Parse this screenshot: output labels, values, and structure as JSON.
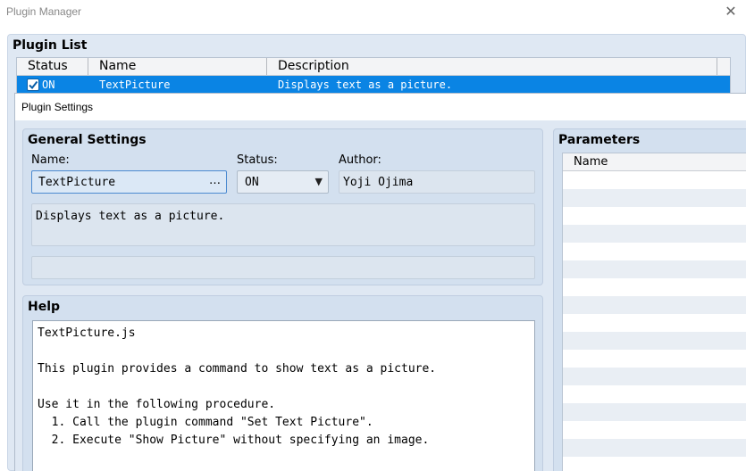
{
  "manager": {
    "title": "Plugin Manager",
    "close_icon": "close-icon",
    "list_title": "Plugin List",
    "columns": [
      "Status",
      "Name",
      "Description"
    ],
    "selected_row": {
      "status": "ON",
      "checked": true,
      "name": "TextPicture",
      "description": "Displays text as a picture."
    }
  },
  "settings": {
    "title": "Plugin Settings",
    "general": {
      "title": "General Settings",
      "name_label": "Name:",
      "name_value": "TextPicture",
      "name_browse": "…",
      "status_label": "Status:",
      "status_value": "ON",
      "author_label": "Author:",
      "author_value": "Yoji Ojima",
      "description_value": "Displays text as a picture.",
      "extra_value": ""
    },
    "help": {
      "title": "Help",
      "lines": [
        "TextPicture.js",
        "",
        "This plugin provides a command to show text as a picture.",
        "",
        "Use it in the following procedure.",
        "  1. Call the plugin command \"Set Text Picture\".",
        "  2. Execute \"Show Picture\" without specifying an image."
      ]
    },
    "parameters": {
      "title": "Parameters",
      "column": "Name"
    }
  },
  "colors": {
    "selection": "#0a84e4",
    "panel": "#dfe8f3",
    "group": "#d3e0ef"
  }
}
